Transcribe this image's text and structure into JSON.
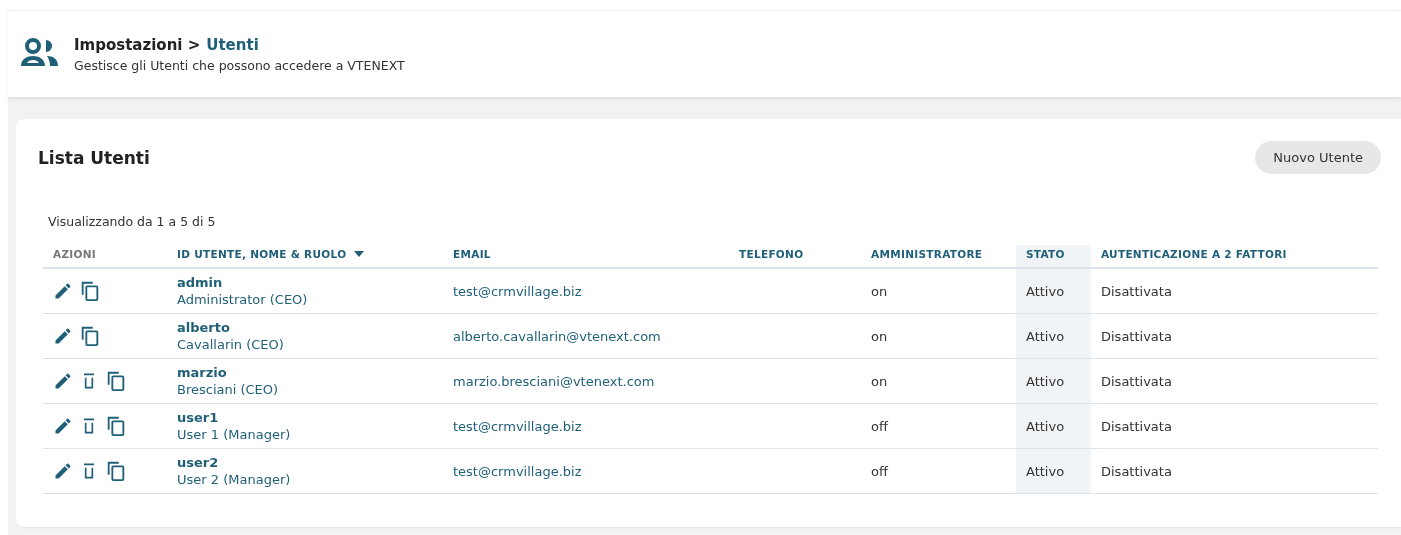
{
  "header": {
    "breadcrumb_parent": "Impostazioni >",
    "breadcrumb_current": "Utenti",
    "subtitle": "Gestisce gli Utenti che possono accedere a VTENEXT"
  },
  "card": {
    "title": "Lista Utenti",
    "button": "Nuovo Utente",
    "summary": "Visualizzando da 1 a 5 di 5"
  },
  "table": {
    "columns": [
      {
        "label": "AZIONI",
        "sortable": false,
        "sorted": false,
        "highlighted": false
      },
      {
        "label": "ID UTENTE, NOME & RUOLO",
        "sortable": true,
        "sorted": true,
        "highlighted": false
      },
      {
        "label": "EMAIL",
        "sortable": true,
        "sorted": false,
        "highlighted": false
      },
      {
        "label": "TELEFONO",
        "sortable": true,
        "sorted": false,
        "highlighted": false
      },
      {
        "label": "AMMINISTRATORE",
        "sortable": true,
        "sorted": false,
        "highlighted": false
      },
      {
        "label": "STATO",
        "sortable": true,
        "sorted": false,
        "highlighted": true
      },
      {
        "label": "AUTENTICAZIONE A 2 FATTORI",
        "sortable": true,
        "sorted": false,
        "highlighted": false
      }
    ],
    "rows": [
      {
        "actions": [
          {
            "kind": "edit"
          },
          {
            "kind": "copy"
          }
        ],
        "user": "admin",
        "name_role": "Administrator (CEO)",
        "email": "test@crmvillage.biz",
        "admin": "on",
        "status": "Attivo",
        "two_factor": "Disattivata"
      },
      {
        "actions": [
          {
            "kind": "edit"
          },
          {
            "kind": "copy"
          }
        ],
        "user": "alberto",
        "name_role": "Cavallarin (CEO)",
        "email": "alberto.cavallarin@vtenext.com",
        "admin": "on",
        "status": "Attivo",
        "two_factor": "Disattivata"
      },
      {
        "actions": [
          {
            "kind": "edit"
          },
          {
            "kind": "delete"
          },
          {
            "kind": "copy"
          }
        ],
        "user": "marzio",
        "name_role": "Bresciani (CEO)",
        "email": "marzio.bresciani@vtenext.com",
        "admin": "on",
        "status": "Attivo",
        "two_factor": "Disattivata"
      },
      {
        "actions": [
          {
            "kind": "edit"
          },
          {
            "kind": "delete"
          },
          {
            "kind": "copy"
          }
        ],
        "user": "user1",
        "name_role": "User 1 (Manager)",
        "email": "test@crmvillage.biz",
        "admin": "off",
        "status": "Attivo",
        "two_factor": "Disattivata"
      },
      {
        "actions": [
          {
            "kind": "edit"
          },
          {
            "kind": "delete"
          },
          {
            "kind": "copy"
          }
        ],
        "user": "user2",
        "name_role": "User 2 (Manager)",
        "email": "test@crmvillage.biz",
        "admin": "off",
        "status": "Attivo",
        "two_factor": "Disattivata"
      }
    ]
  }
}
